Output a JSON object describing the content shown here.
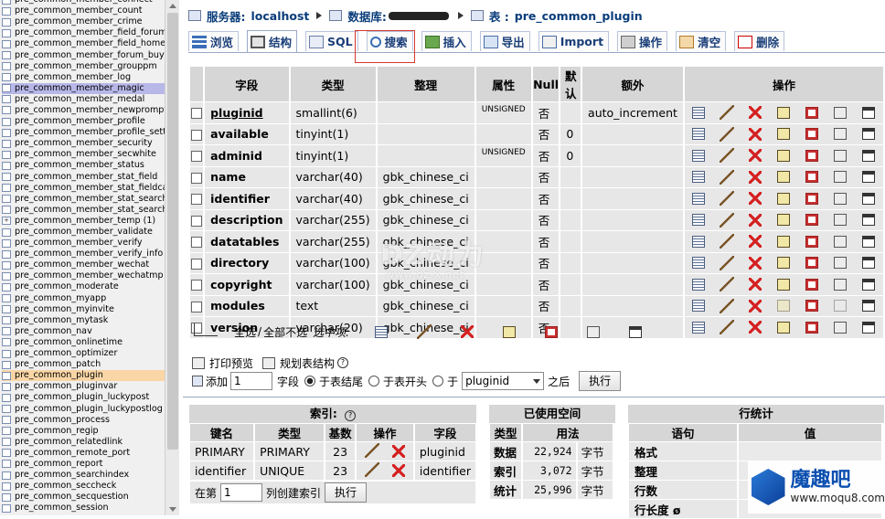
{
  "sidebar": {
    "items": [
      {
        "label": "pre_common_member_connect",
        "state": "normal"
      },
      {
        "label": "pre_common_member_count",
        "state": "normal"
      },
      {
        "label": "pre_common_member_crime",
        "state": "normal"
      },
      {
        "label": "pre_common_member_field_forum",
        "state": "normal"
      },
      {
        "label": "pre_common_member_field_home",
        "state": "normal"
      },
      {
        "label": "pre_common_member_forum_buylog",
        "state": "normal"
      },
      {
        "label": "pre_common_member_grouppm",
        "state": "normal"
      },
      {
        "label": "pre_common_member_log",
        "state": "normal"
      },
      {
        "label": "pre_common_member_magic",
        "state": "highlight"
      },
      {
        "label": "pre_common_member_medal",
        "state": "normal"
      },
      {
        "label": "pre_common_member_newprompt",
        "state": "normal"
      },
      {
        "label": "pre_common_member_profile",
        "state": "normal"
      },
      {
        "label": "pre_common_member_profile_setting",
        "state": "normal"
      },
      {
        "label": "pre_common_member_security",
        "state": "normal"
      },
      {
        "label": "pre_common_member_secwhite",
        "state": "normal"
      },
      {
        "label": "pre_common_member_status",
        "state": "normal"
      },
      {
        "label": "pre_common_member_stat_field",
        "state": "normal"
      },
      {
        "label": "pre_common_member_stat_fieldcache",
        "state": "normal"
      },
      {
        "label": "pre_common_member_stat_search",
        "state": "normal"
      },
      {
        "label": "pre_common_member_stat_searchcache",
        "state": "normal"
      },
      {
        "label": "pre_common_member_temp (1)",
        "state": "expandable"
      },
      {
        "label": "pre_common_member_validate",
        "state": "normal"
      },
      {
        "label": "pre_common_member_verify",
        "state": "normal"
      },
      {
        "label": "pre_common_member_verify_info",
        "state": "normal"
      },
      {
        "label": "pre_common_member_wechat",
        "state": "normal"
      },
      {
        "label": "pre_common_member_wechatmp",
        "state": "normal"
      },
      {
        "label": "pre_common_moderate",
        "state": "normal"
      },
      {
        "label": "pre_common_myapp",
        "state": "normal"
      },
      {
        "label": "pre_common_myinvite",
        "state": "normal"
      },
      {
        "label": "pre_common_mytask",
        "state": "normal"
      },
      {
        "label": "pre_common_nav",
        "state": "normal"
      },
      {
        "label": "pre_common_onlinetime",
        "state": "normal"
      },
      {
        "label": "pre_common_optimizer",
        "state": "normal"
      },
      {
        "label": "pre_common_patch",
        "state": "normal"
      },
      {
        "label": "pre_common_plugin",
        "state": "current"
      },
      {
        "label": "pre_common_pluginvar",
        "state": "normal"
      },
      {
        "label": "pre_common_plugin_luckypost",
        "state": "normal"
      },
      {
        "label": "pre_common_plugin_luckypostlog",
        "state": "normal"
      },
      {
        "label": "pre_common_process",
        "state": "normal"
      },
      {
        "label": "pre_common_regip",
        "state": "normal"
      },
      {
        "label": "pre_common_relatedlink",
        "state": "normal"
      },
      {
        "label": "pre_common_remote_port",
        "state": "normal"
      },
      {
        "label": "pre_common_report",
        "state": "normal"
      },
      {
        "label": "pre_common_searchindex",
        "state": "normal"
      },
      {
        "label": "pre_common_seccheck",
        "state": "normal"
      },
      {
        "label": "pre_common_secquestion",
        "state": "normal"
      },
      {
        "label": "pre_common_session",
        "state": "normal"
      }
    ]
  },
  "breadcrumb": {
    "server_label": "服务器:",
    "server": "localhost",
    "db_label": "数据库:",
    "table_label": "表 :",
    "table": "pre_common_plugin"
  },
  "tabs": [
    {
      "key": "browse",
      "label": "浏览",
      "active": false
    },
    {
      "key": "structure",
      "label": "结构",
      "active": true
    },
    {
      "key": "sql",
      "label": "SQL",
      "active": false
    },
    {
      "key": "search",
      "label": "搜索",
      "active": false
    },
    {
      "key": "insert",
      "label": "插入",
      "active": false
    },
    {
      "key": "export",
      "label": "导出",
      "active": false
    },
    {
      "key": "import",
      "label": "Import",
      "active": false
    },
    {
      "key": "operations",
      "label": "操作",
      "active": false
    },
    {
      "key": "empty",
      "label": "清空",
      "active": false
    },
    {
      "key": "drop",
      "label": "删除",
      "active": false
    }
  ],
  "structure": {
    "headers": {
      "field": "字段",
      "type": "类型",
      "collation": "整理",
      "attributes": "属性",
      "null": "Null",
      "default": "默认",
      "extra": "额外",
      "action": "操作"
    },
    "rows": [
      {
        "field": "pluginid",
        "type": "smallint(6)",
        "collation": "",
        "attributes": "UNSIGNED",
        "null": "否",
        "default": "",
        "extra": "auto_increment",
        "underline": true
      },
      {
        "field": "available",
        "type": "tinyint(1)",
        "collation": "",
        "attributes": "",
        "null": "否",
        "default": "0",
        "extra": ""
      },
      {
        "field": "adminid",
        "type": "tinyint(1)",
        "collation": "",
        "attributes": "UNSIGNED",
        "null": "否",
        "default": "0",
        "extra": ""
      },
      {
        "field": "name",
        "type": "varchar(40)",
        "collation": "gbk_chinese_ci",
        "attributes": "",
        "null": "否",
        "default": "",
        "extra": ""
      },
      {
        "field": "identifier",
        "type": "varchar(40)",
        "collation": "gbk_chinese_ci",
        "attributes": "",
        "null": "否",
        "default": "",
        "extra": ""
      },
      {
        "field": "description",
        "type": "varchar(255)",
        "collation": "gbk_chinese_ci",
        "attributes": "",
        "null": "否",
        "default": "",
        "extra": ""
      },
      {
        "field": "datatables",
        "type": "varchar(255)",
        "collation": "gbk_chinese_ci",
        "attributes": "",
        "null": "否",
        "default": "",
        "extra": ""
      },
      {
        "field": "directory",
        "type": "varchar(100)",
        "collation": "gbk_chinese_ci",
        "attributes": "",
        "null": "否",
        "default": "",
        "extra": ""
      },
      {
        "field": "copyright",
        "type": "varchar(100)",
        "collation": "gbk_chinese_ci",
        "attributes": "",
        "null": "否",
        "default": "",
        "extra": ""
      },
      {
        "field": "modules",
        "type": "text",
        "collation": "gbk_chinese_ci",
        "attributes": "",
        "null": "否",
        "default": "",
        "extra": "",
        "text_type": true
      },
      {
        "field": "version",
        "type": "varchar(20)",
        "collation": "gbk_chinese_ci",
        "attributes": "",
        "null": "否",
        "default": "",
        "extra": ""
      }
    ],
    "row_action_icons": [
      "browse-icon",
      "edit-icon",
      "delete-icon",
      "primary-key-icon",
      "unique-icon",
      "index-icon",
      "fulltext-icon"
    ]
  },
  "bulk": {
    "check_all": "全选",
    "separator": "/",
    "uncheck_all": "全部不选",
    "with_selected": "选中项:"
  },
  "tools": {
    "print": "打印预览",
    "relation": "规划表结构"
  },
  "add_field": {
    "add_label": "添加",
    "count": "1",
    "fields_label": "字段",
    "at_end": "于表结尾",
    "at_begin": "于表开头",
    "after_label": "于",
    "after_field": "pluginid",
    "after_suffix": "之后",
    "go": "执行"
  },
  "indexes": {
    "title": "索引:",
    "headers": {
      "key": "键名",
      "type": "类型",
      "cardinality": "基数",
      "action": "操作",
      "field": "字段"
    },
    "rows": [
      {
        "key": "PRIMARY",
        "type": "PRIMARY",
        "cardinality": "23",
        "field": "pluginid"
      },
      {
        "key": "identifier",
        "type": "UNIQUE",
        "cardinality": "23",
        "field": "identifier"
      }
    ],
    "create_prefix": "在第",
    "create_count": "1",
    "create_suffix": "列创建索引",
    "go": "执行"
  },
  "space": {
    "title": "已使用空间",
    "headers": {
      "type": "类型",
      "usage": "用法"
    },
    "rows": [
      {
        "type": "数据",
        "value": "22,924",
        "unit": "字节"
      },
      {
        "type": "索引",
        "value": "3,072",
        "unit": "字节"
      },
      {
        "type": "统计",
        "value": "25,996",
        "unit": "字节"
      }
    ]
  },
  "stats": {
    "title": "行统计",
    "headers": {
      "statement": "语句",
      "value": "值"
    },
    "rows": [
      {
        "label": "格式",
        "value": ""
      },
      {
        "label": "整理",
        "value": ""
      },
      {
        "label": "行数",
        "value": ""
      },
      {
        "label": "行长度 ø",
        "value": ""
      }
    ]
  },
  "watermarks": {
    "center_brand": "DZ动力",
    "center_url": "www.dz-x.net",
    "corner_brand": "魔趣吧",
    "corner_url": "www.moqu8.com"
  },
  "colors": {
    "header_cell": "#d6d6d6",
    "row_cell": "#e7e7e7",
    "tab_text": "#1a3e78",
    "sidebar_highlight": "#b7b7e8",
    "sidebar_current": "#fad6a6",
    "search_outline": "#d9362e",
    "delete_red": "#d42020"
  }
}
